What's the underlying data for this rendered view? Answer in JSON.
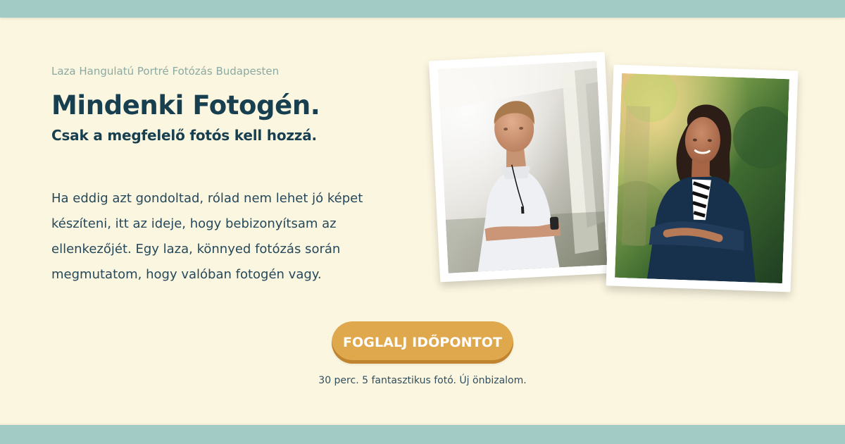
{
  "hero": {
    "eyebrow": "Laza Hangulatú Portré Fotózás Budapesten",
    "headline": "Mindenki Fotogén.",
    "subheadline": "Csak a megfelelő fotós kell hozzá.",
    "body": "Ha eddig azt gondoltad, rólad nem lehet jó képet készíteni, itt az ideje, hogy bebizonyítsam az ellenkezőjét. Egy laza, könnyed fotózás során megmutatom, hogy valóban fotogén vagy."
  },
  "cta": {
    "label": "FOGLALJ IDŐPONTOT",
    "note": "30 perc. 5 fantasztikus fotó. Új önbizalom."
  },
  "colors": {
    "background": "#fbf6e0",
    "accent_band": "#a3cbc5",
    "heading": "#173f4f",
    "cta_button": "#e0a84d"
  }
}
